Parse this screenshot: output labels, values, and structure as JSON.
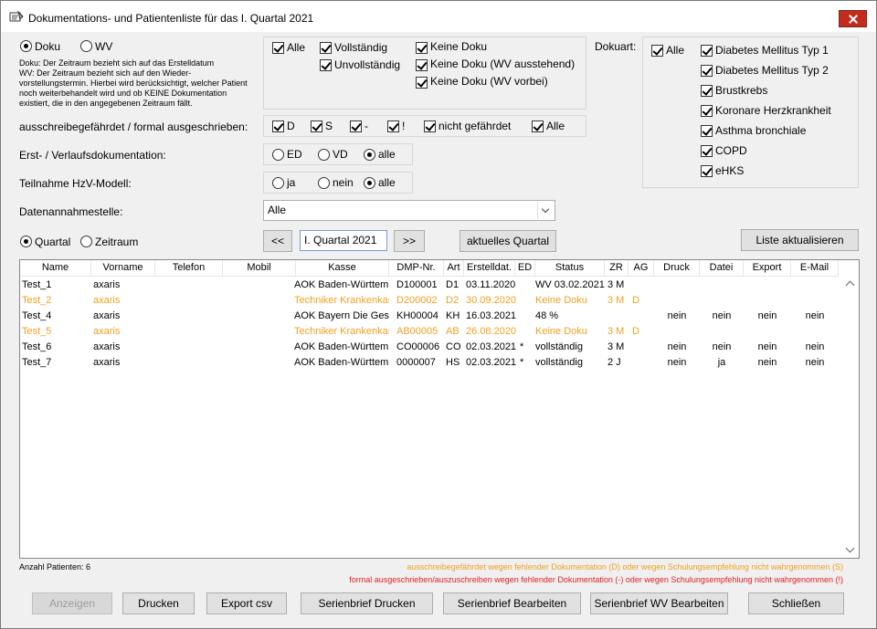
{
  "window": {
    "title": "Dokumentations- und Patientenliste für das I. Quartal 2021"
  },
  "mode": {
    "doku_label": "Doku",
    "wv_label": "WV",
    "selected": "Doku",
    "description": [
      "Doku: Der Zeitraum bezieht sich auf das Erstelldatum",
      "WV: Der Zeitraum bezieht sich auf den Wieder-",
      "vorstellungstermin. Hierbei wird berücksichtigt, welcher Patient",
      "noch weiterbehandelt wird und ob KEINE Dokumentation",
      "existiert, die in den angegebenen Zeitraum fällt."
    ]
  },
  "status_filter": {
    "alle": "Alle",
    "vollstaendig": "Vollständig",
    "unvollstaendig": "Unvollständig",
    "keine_doku": "Keine Doku",
    "keine_doku_wv_ausstehend": "Keine Doku (WV ausstehend)",
    "keine_doku_wv_vorbei": "Keine Doku (WV vorbei)"
  },
  "dokuart": {
    "label": "Dokuart:",
    "alle": "Alle",
    "items": [
      "Diabetes Mellitus Typ 1",
      "Diabetes Mellitus Typ 2",
      "Brustkrebs",
      "Koronare Herzkrankheit",
      "Asthma bronchiale",
      "COPD",
      "eHKS"
    ]
  },
  "ausschreibe": {
    "label": "ausschreibegefährdet / formal ausgeschrieben:",
    "d": "D",
    "s": "S",
    "minus": "-",
    "excl": "!",
    "nicht": "nicht gefährdet",
    "alle": "Alle"
  },
  "erst_verlauf": {
    "label": "Erst- / Verlaufsdokumentation:",
    "ed": "ED",
    "vd": "VD",
    "alle": "alle",
    "selected": "alle"
  },
  "hzv": {
    "label": "Teilnahme HzV-Modell:",
    "ja": "ja",
    "nein": "nein",
    "alle": "alle",
    "selected": "alle"
  },
  "datenannahme": {
    "label": "Datenannahmestelle:",
    "value": "Alle"
  },
  "period": {
    "quartal_label": "Quartal",
    "zeitraum_label": "Zeitraum",
    "selected": "Quartal",
    "prev": "<<",
    "next": ">>",
    "value": "I. Quartal 2021",
    "current_quarter": "aktuelles Quartal",
    "refresh": "Liste aktualisieren"
  },
  "table": {
    "columns": [
      "Name",
      "Vorname",
      "Telefon",
      "Mobil",
      "Kasse",
      "DMP-Nr.",
      "Art",
      "Erstelldat.",
      "ED",
      "Status",
      "ZR",
      "AG",
      "Druck",
      "Datei",
      "Export",
      "E-Mail"
    ],
    "rows": [
      {
        "color": "normal",
        "cells": [
          "Test_1",
          "axaris",
          "",
          "",
          "AOK Baden-Württemberg",
          "D100001",
          "D1",
          "03.11.2020",
          "",
          "WV 03.02.2021",
          "3 M",
          "",
          "",
          "",
          "",
          ""
        ]
      },
      {
        "color": "orange",
        "cells": [
          "Test_2",
          "axaris",
          "",
          "",
          "Techniker Krankenkasse",
          "D200002",
          "D2",
          "30.09.2020",
          "",
          "Keine Doku",
          "3 M",
          "D",
          "",
          "",
          "",
          ""
        ]
      },
      {
        "color": "normal",
        "cells": [
          "Test_4",
          "axaris",
          "",
          "",
          "AOK Bayern Die Gesundheitskasse",
          "KH00004",
          "KH",
          "16.03.2021",
          "",
          "48 %",
          "",
          "",
          "nein",
          "nein",
          "nein",
          "nein"
        ]
      },
      {
        "color": "orange",
        "cells": [
          "Test_5",
          "axaris",
          "",
          "",
          "Techniker Krankenkasse",
          "AB00005",
          "AB",
          "26.08.2020",
          "",
          "Keine Doku",
          "3 M",
          "D",
          "",
          "",
          "",
          ""
        ]
      },
      {
        "color": "normal",
        "cells": [
          "Test_6",
          "axaris",
          "",
          "",
          "AOK Baden-Württemberg",
          "CO00006",
          "CO",
          "02.03.2021",
          "*",
          "vollständig",
          "3 M",
          "",
          "nein",
          "nein",
          "nein",
          "nein"
        ]
      },
      {
        "color": "normal",
        "cells": [
          "Test_7",
          "axaris",
          "",
          "",
          "AOK Baden-Württemberg",
          "0000007",
          "HS",
          "02.03.2021",
          "*",
          "vollständig",
          "2 J",
          "",
          "nein",
          "ja",
          "nein",
          "nein"
        ]
      }
    ]
  },
  "footer": {
    "count": "Anzahl Patienten: 6",
    "legend_orange": "ausschreibegefährdet wegen fehlender Dokumentation (D) oder wegen Schulungsempfehlung nicht wahrgenommen (S)",
    "legend_red": "formal ausgeschrieben/auszuschreiben wegen fehlender Dokumentation (-) oder wegen Schulungsempfehlung nicht wahrgenommen (!)",
    "colors": {
      "orange": "#f0a020",
      "red": "#e0202a"
    }
  },
  "buttons": {
    "anzeigen": "Anzeigen",
    "drucken": "Drucken",
    "export_csv": "Export csv",
    "serienbrief_drucken": "Serienbrief Drucken",
    "serienbrief_bearbeiten": "Serienbrief Bearbeiten",
    "serienbrief_wv_bearbeiten": "Serienbrief WV Bearbeiten",
    "schliessen": "Schließen"
  }
}
